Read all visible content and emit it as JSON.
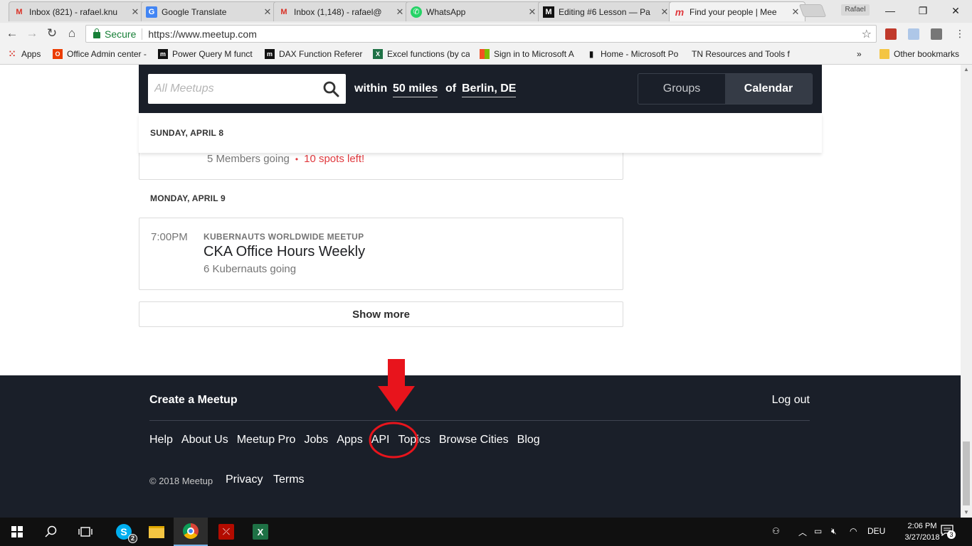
{
  "browser": {
    "tabs": [
      {
        "title": "Inbox (821) - rafael.knu",
        "icon": "gmail-icon"
      },
      {
        "title": "Google Translate",
        "icon": "translate-icon"
      },
      {
        "title": "Inbox (1,148) - rafael@",
        "icon": "gmail-icon"
      },
      {
        "title": "WhatsApp",
        "icon": "whatsapp-icon"
      },
      {
        "title": "Editing #6 Lesson — Pa",
        "icon": "medium-icon"
      },
      {
        "title": "Find your people | Mee",
        "icon": "meetup-icon"
      }
    ],
    "profile_name": "Rafael",
    "secure_label": "Secure",
    "url": "https://www.meetup.com",
    "bookmarks": [
      {
        "label": "Apps"
      },
      {
        "label": "Office Admin center -"
      },
      {
        "label": "Power Query M funct"
      },
      {
        "label": "DAX Function Referer"
      },
      {
        "label": "Excel functions (by ca"
      },
      {
        "label": "Sign in to Microsoft A"
      },
      {
        "label": "Home - Microsoft Po"
      },
      {
        "label": "TN Resources and Tools f"
      },
      {
        "label": "Other bookmarks"
      }
    ],
    "bookmarks_overflow": "»"
  },
  "search": {
    "placeholder": "All Meetups",
    "within_label": "within",
    "distance": "50 miles",
    "of_label": "of",
    "location": "Berlin, DE",
    "toggle": {
      "groups": "Groups",
      "calendar": "Calendar"
    }
  },
  "calendar": {
    "sticky_date": "SUNDAY, APRIL 8",
    "partial_event": {
      "going": "5 Members going",
      "spots": "10 spots left!"
    },
    "day2": {
      "date": "MONDAY, APRIL 9",
      "event": {
        "time": "7:00PM",
        "group": "KUBERNAUTS WORLDWIDE MEETUP",
        "title": "CKA Office Hours Weekly",
        "going": "6 Kubernauts going"
      }
    },
    "show_more": "Show more"
  },
  "footer": {
    "create": "Create a Meetup",
    "logout": "Log out",
    "links": [
      "Help",
      "About Us",
      "Meetup Pro",
      "Jobs",
      "Apps",
      "API",
      "Topics",
      "Browse Cities",
      "Blog"
    ],
    "copyright": "© 2018 Meetup",
    "privacy": "Privacy",
    "terms": "Terms"
  },
  "taskbar": {
    "skype_badge": "2",
    "language": "DEU",
    "time": "2:06 PM",
    "date": "3/27/2018",
    "notifications": "3"
  },
  "colors": {
    "meetup_dark": "#1a1f29",
    "accent_red": "#e0393e",
    "annotation_red": "#e8141c"
  }
}
